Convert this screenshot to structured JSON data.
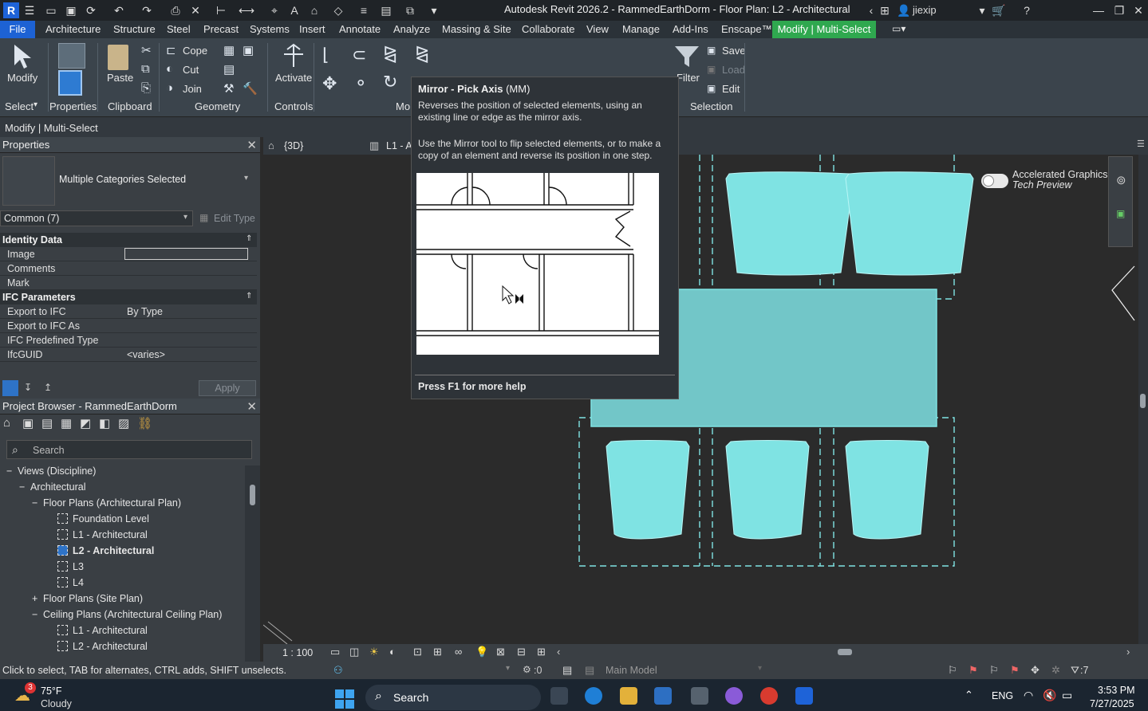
{
  "titlebar": {
    "title": "Autodesk Revit 2026.2 - RammedEarthDorm - Floor Plan: L2 - Architectural",
    "user": "jiexip",
    "app_logo": "R"
  },
  "menu": {
    "file": "File",
    "items": [
      "Architecture",
      "Structure",
      "Steel",
      "Precast",
      "Systems",
      "Insert",
      "Annotate",
      "Analyze",
      "Massing & Site",
      "Collaborate",
      "View",
      "Manage",
      "Add-Ins",
      "Enscape™"
    ],
    "active": "Modify | Multi-Select"
  },
  "ribbon": {
    "modify_label": "Modify",
    "select_label": "Select",
    "properties_label": "Properties",
    "paste_label": "Paste",
    "clipboard_label": "Clipboard",
    "cope_label": "Cope",
    "cut_label": "Cut",
    "join_label": "Join",
    "geometry_label": "Geometry",
    "activate_label": "Activate",
    "controls_label": "Controls",
    "modify_group_label": "Mo",
    "filter_label": "Filter",
    "save_label": "Save",
    "load_label": "Load",
    "edit_label": "Edit",
    "selection_label": "Selection"
  },
  "context_bar": {
    "text": "Modify | Multi-Select"
  },
  "properties": {
    "header": "Properties",
    "type_name": "Multiple Categories Selected",
    "filter": "Common (7)",
    "edit_type": "Edit Type",
    "categories": [
      {
        "name": "Identity Data",
        "rows": [
          {
            "k": "Image",
            "v": ""
          },
          {
            "k": "Comments",
            "v": ""
          },
          {
            "k": "Mark",
            "v": ""
          }
        ]
      },
      {
        "name": "IFC Parameters",
        "rows": [
          {
            "k": "Export to IFC",
            "v": "By Type"
          },
          {
            "k": "Export to IFC As",
            "v": ""
          },
          {
            "k": "IFC Predefined Type",
            "v": ""
          },
          {
            "k": "IfcGUID",
            "v": "<varies>"
          }
        ]
      }
    ],
    "apply": "Apply"
  },
  "browser": {
    "header": "Project Browser - RammedEarthDorm",
    "search_placeholder": "Search",
    "tree": [
      {
        "label": "Views (Discipline)",
        "indent": 0,
        "toggle": "−"
      },
      {
        "label": "Architectural",
        "indent": 1,
        "toggle": "−"
      },
      {
        "label": "Floor Plans (Architectural Plan)",
        "indent": 2,
        "toggle": "−"
      },
      {
        "label": "Foundation Level",
        "indent": 3
      },
      {
        "label": "L1 - Architectural",
        "indent": 3
      },
      {
        "label": "L2 - Architectural",
        "indent": 3,
        "bold": true
      },
      {
        "label": "L3",
        "indent": 3
      },
      {
        "label": "L4",
        "indent": 3
      },
      {
        "label": "Floor Plans (Site Plan)",
        "indent": 2,
        "toggle": "+"
      },
      {
        "label": "Ceiling Plans (Architectural Ceiling Plan)",
        "indent": 2,
        "toggle": "−"
      },
      {
        "label": "L1 - Architectural",
        "indent": 3
      },
      {
        "label": "L2 - Architectural",
        "indent": 3
      }
    ]
  },
  "view_tabs": {
    "tab1": "{3D}",
    "tab2": "L1 - A"
  },
  "canvas": {
    "graphics_label": "Accelerated Graphics",
    "graphics_sub": "Tech Preview"
  },
  "view_control": {
    "scale": "1 : 100"
  },
  "status": {
    "text": "Click to select, TAB for alternates, CTRL adds, SHIFT unselects.",
    "count": ":0",
    "model": "Main Model",
    "filter_count": ":7"
  },
  "tooltip": {
    "title": "Mirror - Pick Axis",
    "shortcut": "(MM)",
    "desc1": "Reverses the position of selected elements, using an existing line or edge as the mirror axis.",
    "desc2": "Use the Mirror tool to flip selected elements, or to make a copy of an element and reverse its position in one step.",
    "help": "Press F1 for more help"
  },
  "taskbar": {
    "weather_temp": "75°F",
    "weather_desc": "Cloudy",
    "weather_badge": "3",
    "search": "Search",
    "lang": "ENG",
    "time": "3:53 PM",
    "date": "7/27/2025"
  },
  "colors": {
    "accent": "#1d62d4",
    "context_tab": "#2fa84f",
    "selection": "#7fe3e3"
  }
}
